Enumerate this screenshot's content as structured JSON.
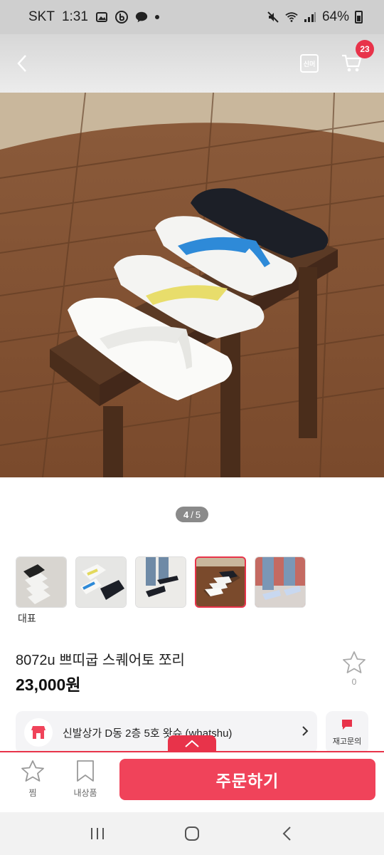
{
  "status_bar": {
    "carrier": "SKT",
    "time": "1:31",
    "battery": "64%"
  },
  "header": {
    "brand_mark": "신머",
    "cart_count": "23",
    "icons": [
      "back-arrow-icon",
      "cart-icon"
    ]
  },
  "gallery": {
    "current": "4",
    "separator": "/",
    "total": "5",
    "selected_index": 3,
    "thumb_caption": "대표"
  },
  "product": {
    "name": "8072u 쁘띠굽 스퀘어토 쪼리",
    "price": "23,000원",
    "fav_count": "0"
  },
  "store": {
    "name": "신발상가 D동 2층 5호 왓슈 (whatshu)",
    "inquiry_label": "재고문의"
  },
  "actions": {
    "wish_label": "찜",
    "closet_label": "내상품",
    "order_label": "주문하기"
  },
  "colors": {
    "accent": "#e8334a",
    "order_button": "#f0435a"
  }
}
